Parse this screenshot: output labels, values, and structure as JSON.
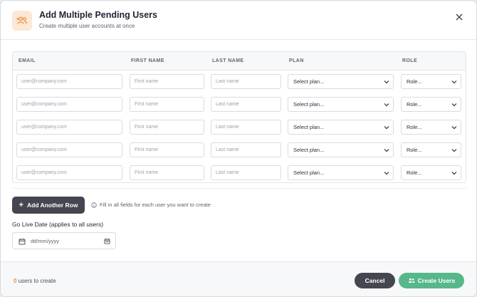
{
  "header": {
    "title": "Add Multiple Pending Users",
    "subtitle": "Create multiple user accounts at once",
    "icon": "users-add-icon"
  },
  "table": {
    "columns": [
      "EMAIL",
      "FIRST NAME",
      "LAST NAME",
      "PLAN",
      "ROLE"
    ],
    "rows": [
      {
        "email_placeholder": "user@company.com",
        "first_placeholder": "First name",
        "last_placeholder": "Last name",
        "plan": "Select plan...",
        "role": "Role..."
      },
      {
        "email_placeholder": "user@company.com",
        "first_placeholder": "First name",
        "last_placeholder": "Last name",
        "plan": "Select plan...",
        "role": "Role..."
      },
      {
        "email_placeholder": "user@company.com",
        "first_placeholder": "First name",
        "last_placeholder": "Last name",
        "plan": "Select plan...",
        "role": "Role..."
      },
      {
        "email_placeholder": "user@company.com",
        "first_placeholder": "First name",
        "last_placeholder": "Last name",
        "plan": "Select plan...",
        "role": "Role..."
      },
      {
        "email_placeholder": "user@company.com",
        "first_placeholder": "First name",
        "last_placeholder": "Last name",
        "plan": "Select plan...",
        "role": "Role..."
      }
    ]
  },
  "actions": {
    "add_row_label": "Add Another Row",
    "hint": "Fill in all fields for each user you want to create"
  },
  "go_live": {
    "label": "Go Live Date (applies to all users)",
    "placeholder": "dd/mm/yyyy"
  },
  "footer": {
    "count": "0",
    "count_suffix": "users to create",
    "cancel_label": "Cancel",
    "create_label": "Create Users"
  },
  "colors": {
    "accent_orange": "#e8913a",
    "create_green": "#57b788",
    "dark_button": "#454650"
  }
}
